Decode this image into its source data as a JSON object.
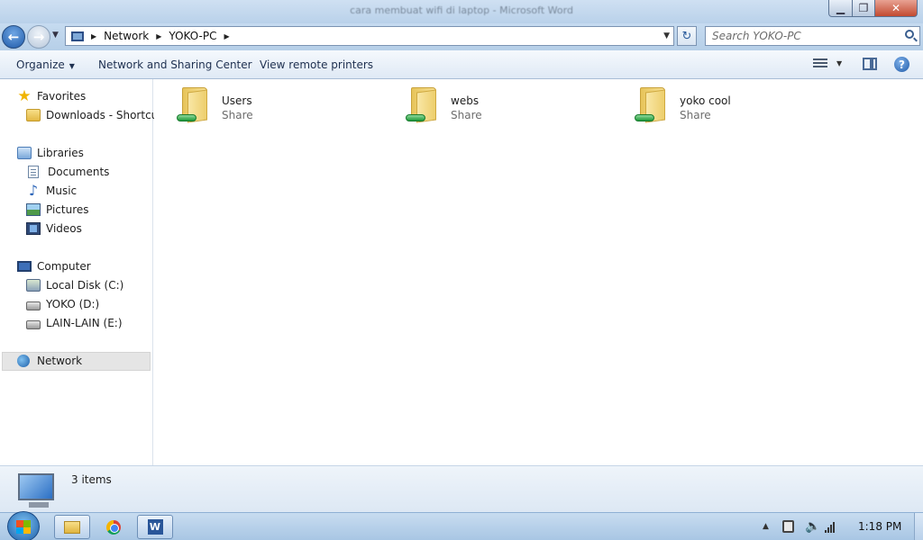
{
  "window": {
    "title": "cara membuat wifi di laptop - Microsoft Word",
    "minimize_label": "▁",
    "maximize_label": "❐",
    "close_label": "✕"
  },
  "address": {
    "crumbs": [
      "Network",
      "YOKO-PC"
    ],
    "search_placeholder": "Search YOKO-PC",
    "back_label": "←",
    "forward_label": "→",
    "refresh_label": "↻"
  },
  "toolbar": {
    "organize_label": "Organize",
    "network_sharing_center_label": "Network and Sharing Center",
    "view_remote_printers_label": "View remote printers",
    "help_label": "?"
  },
  "nav": {
    "favorites": "Favorites",
    "downloads": "Downloads - Shortcut",
    "libraries": "Libraries",
    "documents": "Documents",
    "music": "Music",
    "pictures": "Pictures",
    "videos": "Videos",
    "computer": "Computer",
    "local_disk": "Local Disk (C:)",
    "yoko": "YOKO (D:)",
    "lain": "LAIN-LAIN (E:)",
    "network": "Network"
  },
  "shares": [
    {
      "name": "Users",
      "type": "Share"
    },
    {
      "name": "webs",
      "type": "Share"
    },
    {
      "name": "yoko cool",
      "type": "Share"
    }
  ],
  "details": {
    "count_text": "3 items"
  },
  "taskbar": {
    "word_label": "W",
    "clock": "1:18 PM"
  }
}
